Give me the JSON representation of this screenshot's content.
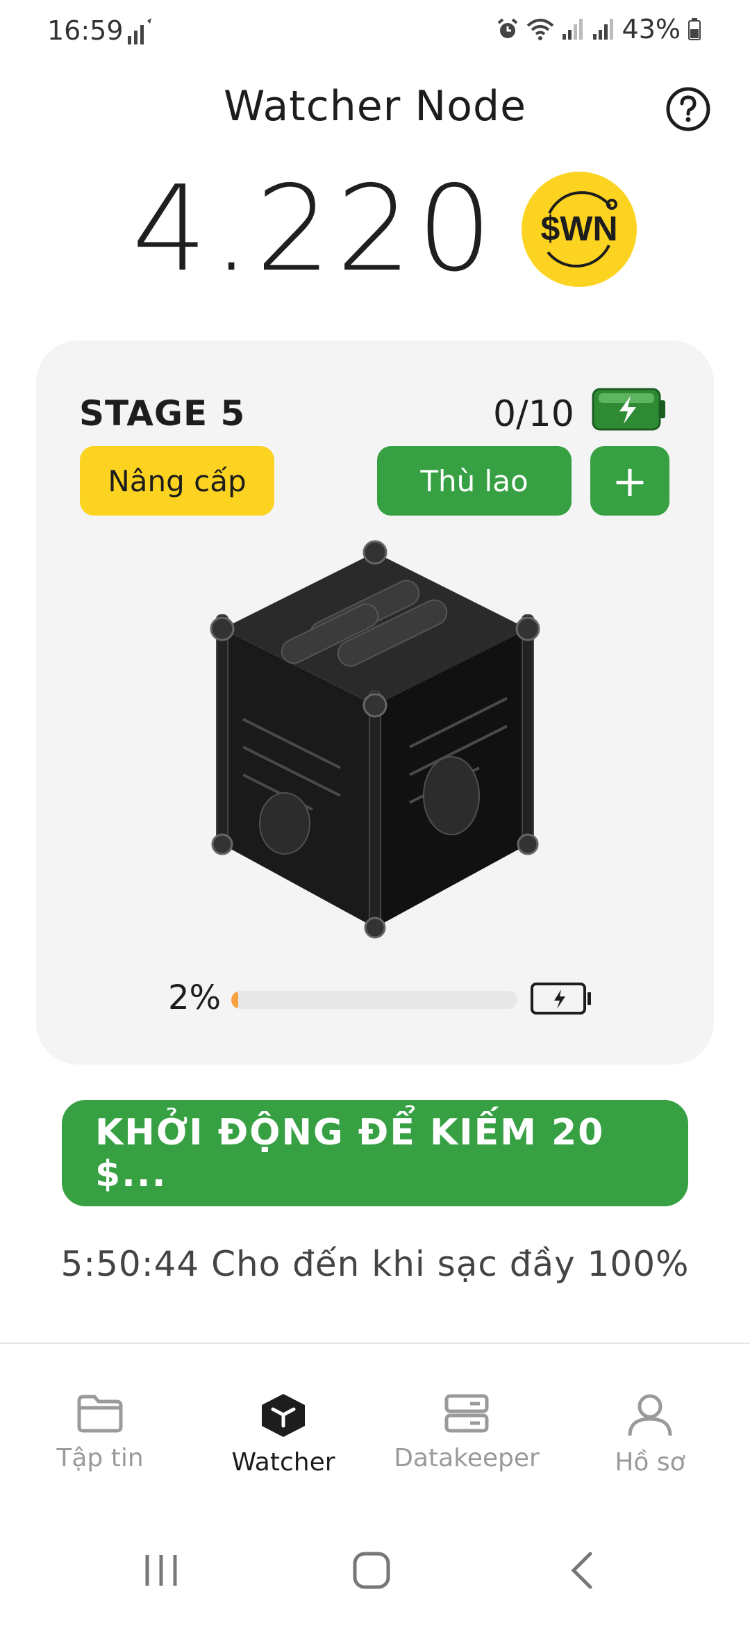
{
  "status_bar": {
    "time": "16:59",
    "battery": "43%"
  },
  "header": {
    "title": "Watcher Node",
    "help_icon": "help-circle-icon"
  },
  "balance": {
    "value": "4.220",
    "token_symbol": "$WN",
    "token_color": "#fcd320"
  },
  "node_card": {
    "stage": "STAGE 5",
    "energy": "0/10",
    "upgrade_label": "Nâng cấp",
    "reward_label": "Thù lao",
    "add_label": "+",
    "progress_percent": 2,
    "progress_label": "2%"
  },
  "action": {
    "start_label": "KHỞI ĐỘNG ĐỂ KIẾM 20   $...",
    "countdown": "5:50:44 Cho đến khi sạc đầy 100%"
  },
  "bottom_nav": {
    "items": [
      {
        "label": "Tập tin",
        "icon": "folder-icon",
        "active": false
      },
      {
        "label": "Watcher",
        "icon": "cube-icon",
        "active": true
      },
      {
        "label": "Datakeeper",
        "icon": "server-icon",
        "active": false
      },
      {
        "label": "Hồ sơ",
        "icon": "user-icon",
        "active": false
      }
    ]
  },
  "colors": {
    "accent_green": "#36a043",
    "accent_yellow": "#fcd320",
    "progress_orange": "#f7a23f"
  }
}
